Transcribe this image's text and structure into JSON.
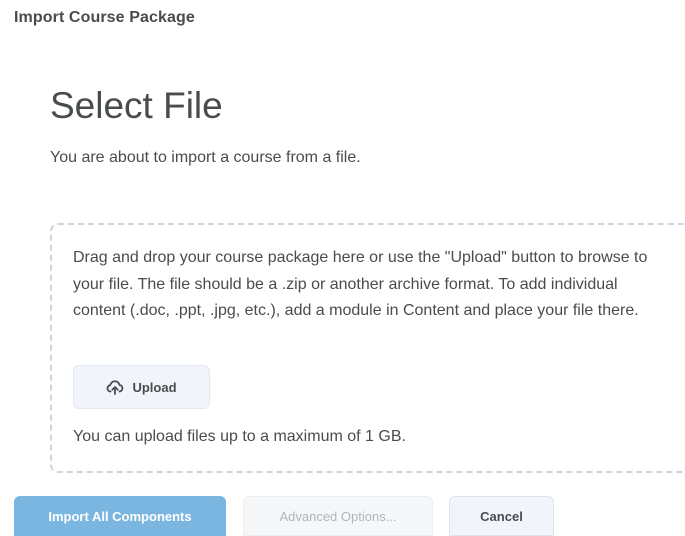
{
  "header": {
    "title": "Import Course Package"
  },
  "main": {
    "title": "Select File",
    "intro": "You are about to import a course from a file."
  },
  "dropzone": {
    "instructions": "Drag and drop your course package here or use the \"Upload\" button to browse to your file. The file should be a .zip or another archive format. To add individual content (.doc, .ppt, .jpg, etc.), add a module in Content and place your file there.",
    "upload_label": "Upload",
    "upload_icon": "upload-cloud-icon",
    "limit_text": "You can upload files up to a maximum of 1 GB."
  },
  "footer": {
    "import_all_label": "Import All Components",
    "advanced_label": "Advanced Options...",
    "cancel_label": "Cancel"
  },
  "colors": {
    "primary_button": "#7ab6e0",
    "text": "#494c4e",
    "secondary_button_bg": "#f1f5fb",
    "dropzone_border": "#cdd5dc"
  }
}
